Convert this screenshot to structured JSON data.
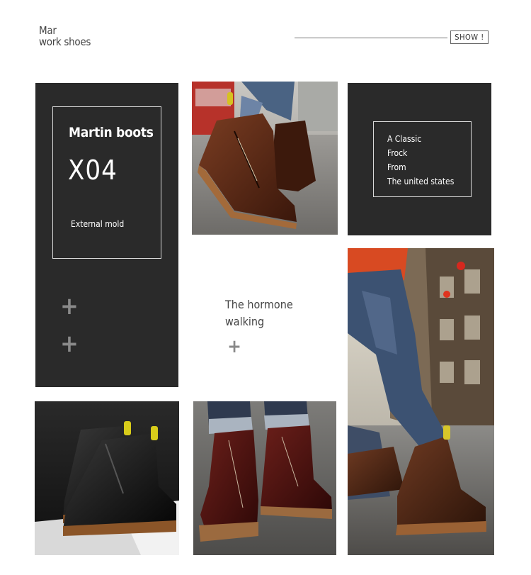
{
  "header": {
    "brand_line1": "Mar",
    "brand_line2": "work shoes",
    "show_button": "SHOW !"
  },
  "panel_left": {
    "title": "Martin boots",
    "model": "X04",
    "subtitle": "External mold"
  },
  "panel_right": {
    "lines": [
      "A Classic",
      "Frock",
      "From",
      "The united states"
    ]
  },
  "middle": {
    "line1": "The hormone",
    "line2": "walking"
  },
  "colors": {
    "panel": "#2a2a2a",
    "leather_brown": "#5a2a17",
    "leather_black": "#141414",
    "denim": "#3d4f68"
  },
  "images": [
    "brown-boots-street-photo",
    "boots-city-street-photo",
    "black-boots-photo",
    "burgundy-boots-photo"
  ]
}
